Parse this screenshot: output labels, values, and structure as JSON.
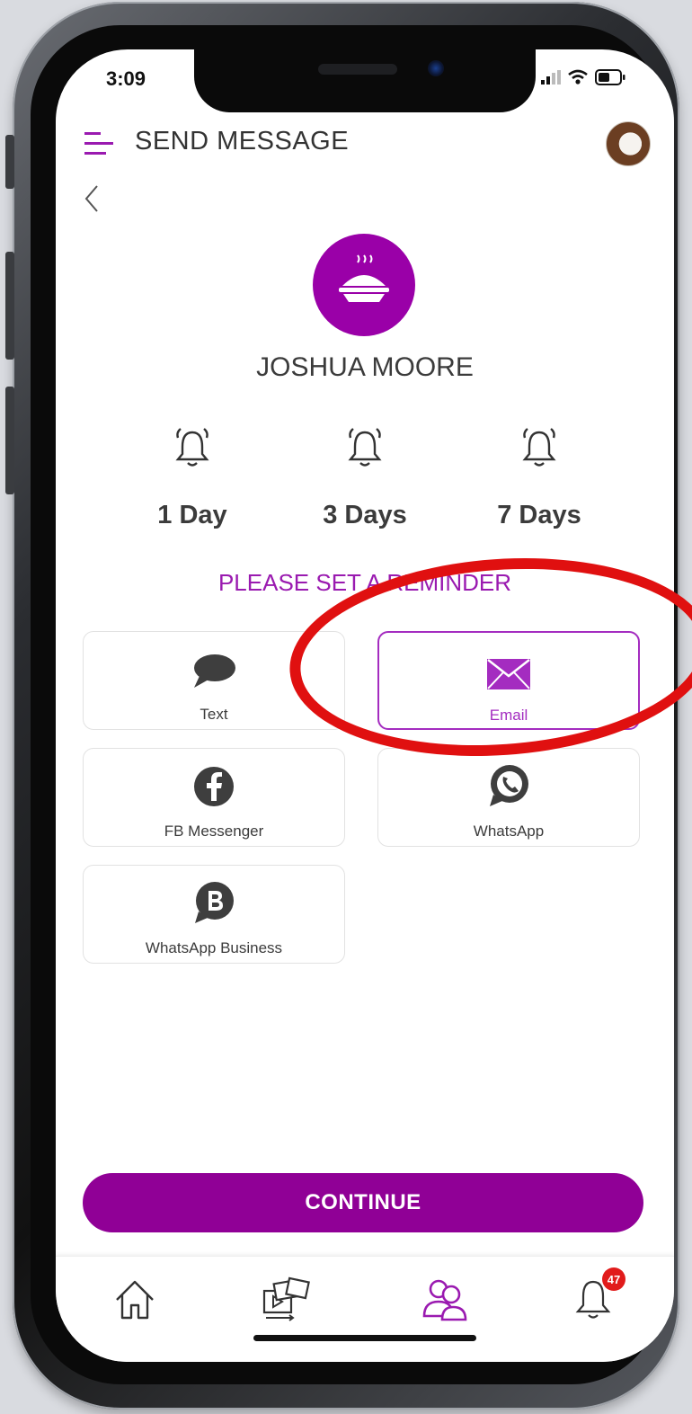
{
  "status": {
    "time": "3:09"
  },
  "header": {
    "title": "SEND MESSAGE"
  },
  "contact": {
    "name": "JOSHUA MOORE"
  },
  "reminders": [
    {
      "label": "1 Day"
    },
    {
      "label": "3 Days"
    },
    {
      "label": "7 Days"
    }
  ],
  "reminder_prompt": "PLEASE SET A REMINDER",
  "channels": [
    {
      "label": "Text",
      "icon": "chat-bubble-icon",
      "selected": false
    },
    {
      "label": "Email",
      "icon": "envelope-icon",
      "selected": true
    },
    {
      "label": "FB Messenger",
      "icon": "facebook-icon",
      "selected": false
    },
    {
      "label": "WhatsApp",
      "icon": "whatsapp-icon",
      "selected": false
    },
    {
      "label": "WhatsApp Business",
      "icon": "whatsapp-business-icon",
      "selected": false
    }
  ],
  "continue_label": "CONTINUE",
  "nav": {
    "items": [
      "home-icon",
      "media-icon",
      "contacts-icon",
      "notifications-icon"
    ],
    "active": "contacts-icon",
    "notification_count": "47"
  },
  "colors": {
    "accent": "#900096",
    "selected_border": "#a42cc0",
    "annotation": "#e01010"
  }
}
